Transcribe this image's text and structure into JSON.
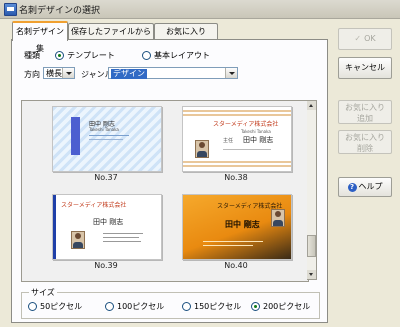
{
  "window": {
    "title": "名刺デザインの選択"
  },
  "tabs": [
    {
      "label": "名刺デザイン集"
    },
    {
      "label": "保存したファイルから"
    },
    {
      "label": "お気に入り"
    }
  ],
  "type_row": {
    "label": "種類",
    "options": [
      "テンプレート",
      "基本レイアウト"
    ],
    "selected": "テンプレート"
  },
  "filter_row": {
    "direction_label": "方向",
    "direction_value": "横長",
    "genre_label": "ジャンル",
    "genre_value": "デザイン"
  },
  "gallery": {
    "items": [
      {
        "caption": "No.37",
        "name": "田中 剛志",
        "romaji": "Takeshi Tanaka"
      },
      {
        "caption": "No.38",
        "company": "スターメディア株式会社",
        "name": "田中 剛志",
        "role": "主任",
        "romaji": "Takeshi Tanaka"
      },
      {
        "caption": "No.39",
        "company": "スターメディア株式会社",
        "name": "田中 剛志"
      },
      {
        "caption": "No.40",
        "company": "スターメディア株式会社",
        "name": "田中 剛志"
      }
    ]
  },
  "size_group": {
    "label": "サイズ",
    "options": [
      "50ピクセル",
      "100ピクセル",
      "150ピクセル",
      "200ピクセル"
    ],
    "selected": "200ピクセル"
  },
  "buttons": {
    "ok": "OK",
    "cancel": "キャンセル",
    "fav_add": [
      "お気に入り",
      "追加"
    ],
    "fav_remove": [
      "お気に入り",
      "削除"
    ],
    "help": "ヘルプ"
  },
  "colors": {
    "accent_tab": "#f0a030",
    "selection": "#316ac5",
    "radio_dot": "#0f7a16"
  }
}
